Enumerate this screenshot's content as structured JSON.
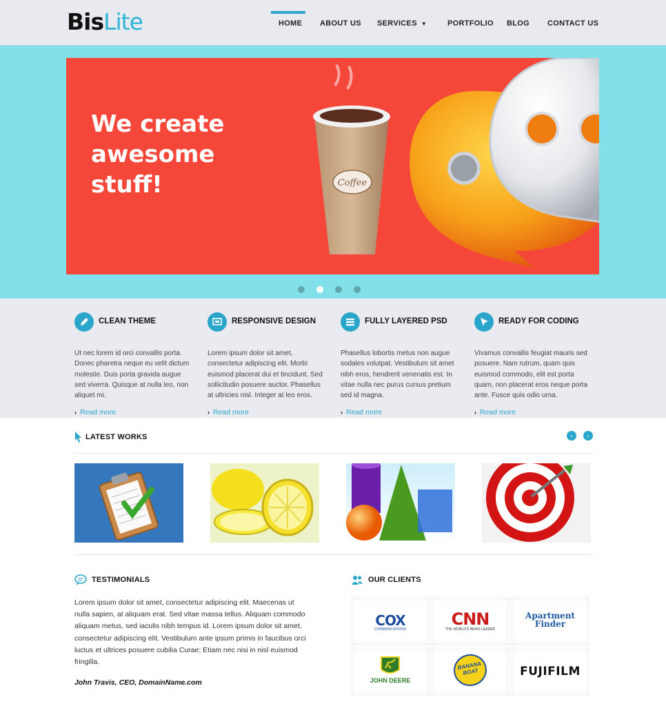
{
  "brand": {
    "bold": "Bis",
    "light": "Lite"
  },
  "nav": {
    "home": "HOME",
    "about": "ABOUT US",
    "services": "SERVICES",
    "portfolio": "PORTFOLIO",
    "blog": "BLOG",
    "contact": "CONTACT US"
  },
  "hero": {
    "line1": "We create",
    "line2": "awesome",
    "line3": "stuff!",
    "cup_label": "Coffee",
    "slides": 4,
    "active_slide": 2
  },
  "features": [
    {
      "icon": "pencil-icon",
      "title": "CLEAN THEME",
      "text": "Ut nec lorem id orci convallis porta. Donec pharetra neque eu velit dictum molestie. Duis porta gravida augue sed viverra. Quisque at nulla leo, non aliquet mi.",
      "link": "Read more"
    },
    {
      "icon": "monitor-icon",
      "title": "RESPONSIVE DESIGN",
      "text": "Lorem ipsum dolor sit amet, consectetur adipiscing elit. Morbi euismod placerat dui et tincidunt. Sed sollicitudin posuere auctor. Phasellus at ultricies nisl. Integer at leo eros.",
      "link": "Read more"
    },
    {
      "icon": "layers-icon",
      "title": "FULLY LAYERED PSD",
      "text": "Phasellus lobortis metus non augue sodales volutpat. Vestibulum sit amet nibh eros, hendrerit venenatis est. In vitae nulla nec purus cursus pretium sed id magna.",
      "link": "Read more"
    },
    {
      "icon": "cursor-icon",
      "title": "READY FOR CODING",
      "text": "Vivamus convallis feugiat mauris sed posuere. Nam rutrum, quam quis euismod commodo, elit est porta quam, non placerat eros neque porta ante. Fusce quis odio urna.",
      "link": "Read more"
    }
  ],
  "works": {
    "title": "LATEST WORKS",
    "prev": "‹",
    "next": "›",
    "items": [
      "clipboard-image",
      "lemons-image",
      "shapes-image",
      "target-image"
    ]
  },
  "testimonials": {
    "title": "TESTIMONIALS",
    "text": "Lorem ipsum dolor sit amet, consectetur adipiscing elit. Maecenas ut nulla sapien, at aliquam erat. Sed vitae massa tellus. Aliquam commodo aliquam metus, sed iaculis nibh tempus id. Lorem ipsum dolor sit amet, consectetur adipiscing elit. Vestibulum ante ipsum primis in faucibus orci luctus et ultrices posuere cubilia Curae; Etiam nec nisi in nisl euismod fringilla.",
    "author": "John Travis, CEO, DomainName.com"
  },
  "clients": {
    "title": "OUR CLIENTS",
    "cox": "COX",
    "cox_sub": "COMMUNICATIONS",
    "cnn": "CNN",
    "cnn_sub": "THE WORLD'S NEWS LEADER",
    "apt1": "Apartment",
    "apt2": "Finder",
    "deere": "JOHN DEERE",
    "banana1": "BANANA",
    "banana2": "BOAT",
    "fuji": "FUJIFILM"
  },
  "colors": {
    "accent": "#2ba6cb",
    "hero_bg": "#82e0ea",
    "slide_bg": "#f4473a",
    "header_bg": "#e8eaf0"
  }
}
